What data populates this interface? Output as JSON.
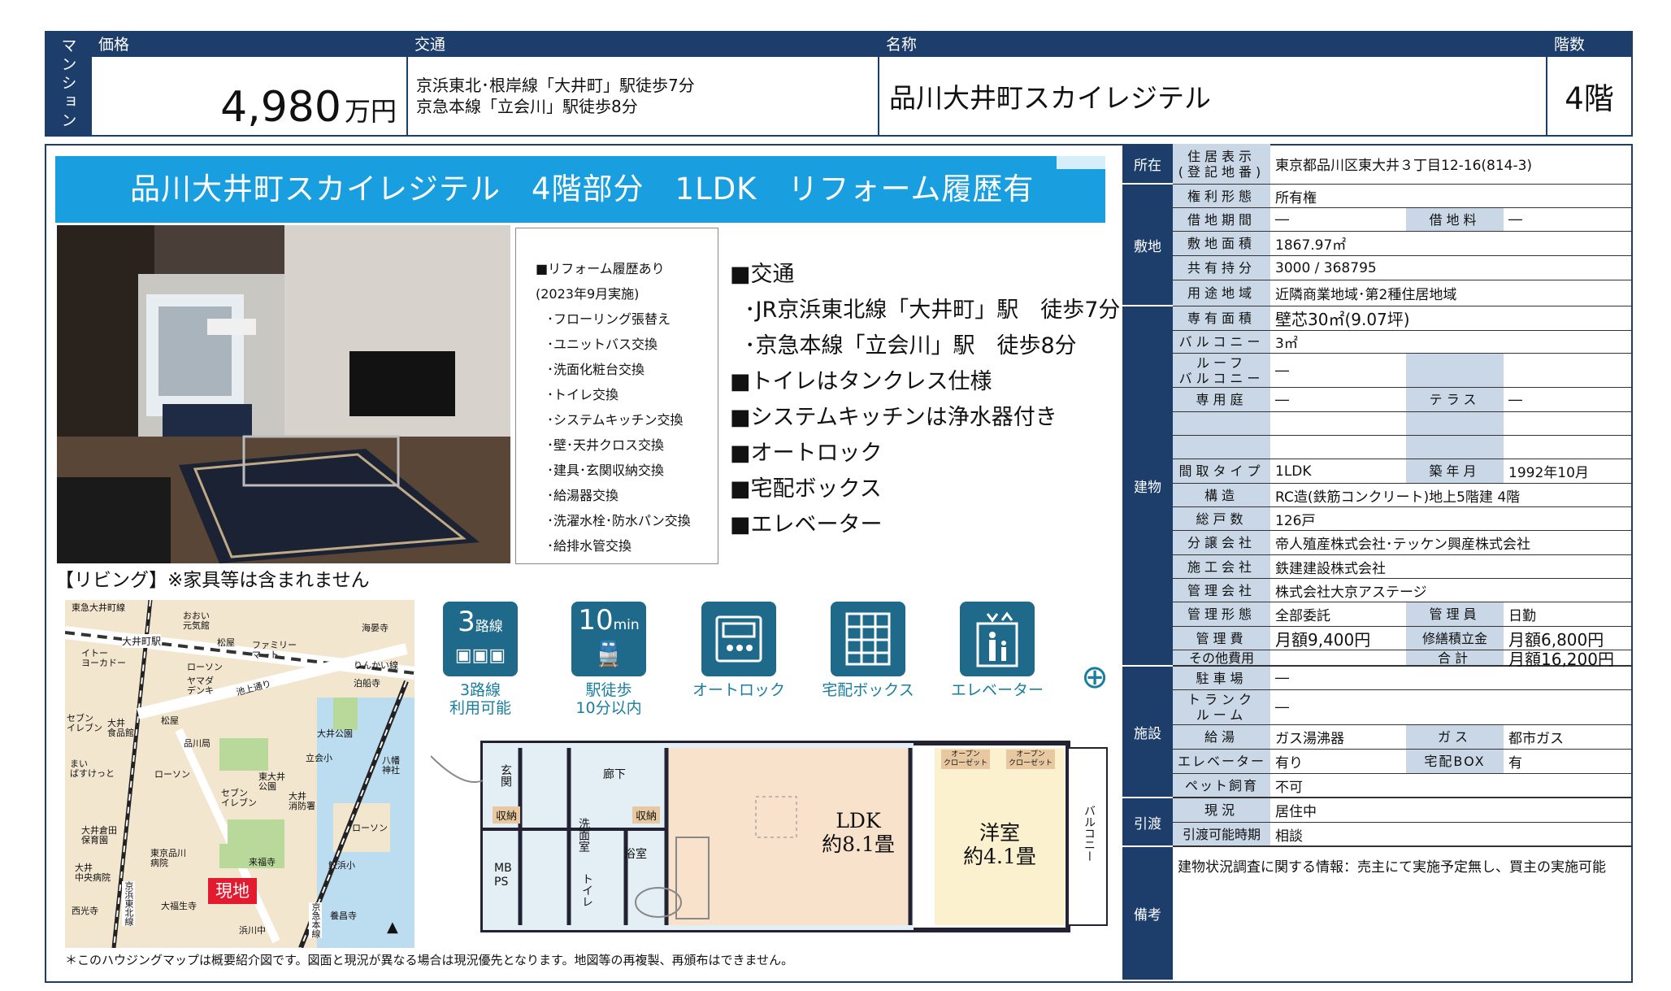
{
  "header": {
    "type_label": "マンション",
    "price_label": "価格",
    "price_value": "4,980",
    "price_unit": "万円",
    "transport_label": "交通",
    "transport_lines": [
      "京浜東北･根岸線「大井町」駅徒歩7分",
      "京急本線「立会川」駅徒歩8分"
    ],
    "name_label": "名称",
    "name_value": "品川大井町スカイレジテル",
    "floor_label": "階数",
    "floor_value": "4階"
  },
  "banner": {
    "title": "品川大井町スカイレジテル　4階部分　1LDK　リフォーム履歴有"
  },
  "photo": {
    "caption": "【リビング】※家具等は含まれません"
  },
  "reform": {
    "lines": [
      "■リフォーム履歴あり",
      "(2023年9月実施)",
      "･フローリング張替え",
      "･ユニットバス交換",
      "･洗面化粧台交換",
      "･トイレ交換",
      "･システムキッチン交換",
      "･壁･天井クロス交換",
      "･建具･玄関収納交換",
      "･給湯器交換",
      "･洗濯水栓･防水パン交換",
      "･給排水管交換"
    ]
  },
  "features": [
    "■交通",
    "･JR京浜東北線「大井町」駅　徒歩7分",
    "･京急本線「立会川」駅　徒歩8分",
    "■トイレはタンクレス仕様",
    "■システムキッチンは浄水器付き",
    "■オートロック",
    "■宅配ボックス",
    "■エレベーター"
  ],
  "icons": [
    {
      "top": "3",
      "top_unit": "路線",
      "label": "3路線\n利用可能",
      "icon": "train-lines-icon"
    },
    {
      "top": "10",
      "top_unit": "min",
      "label": "駅徒歩\n10分以内",
      "icon": "train-icon"
    },
    {
      "label": "オートロック",
      "icon": "intercom-icon"
    },
    {
      "label": "宅配ボックス",
      "icon": "delivery-box-icon"
    },
    {
      "label": "エレベーター",
      "icon": "elevator-icon"
    }
  ],
  "map": {
    "labels": [
      "東急大井町線",
      "おおい\n元気館",
      "松屋",
      "ファミリー\nマート",
      "大井町駅",
      "イトー\nヨーカドー",
      "ローソン",
      "ヤマダ\nデンキ",
      "池上通り",
      "海晏寺",
      "りんかい線",
      "泊船寺",
      "セブン\nイレブン",
      "大井\n食品館",
      "松屋",
      "品川局",
      "大井公園",
      "立会小",
      "八幡\n神社",
      "まい\nばすけっと",
      "ローソン",
      "東大井\n公園",
      "セブン\nイレブン",
      "大井\n消防署",
      "大井倉田\n保育園",
      "東京品川\n病院",
      "来福寺",
      "ローソン",
      "大井\n中央病院",
      "鮫浜小",
      "西光寺",
      "大福生寺",
      "浜川中",
      "養昌寺",
      "京浜東北線",
      "京急本線",
      "現地"
    ]
  },
  "floorplan": {
    "labels": [
      "玄関",
      "廊下",
      "収納",
      "収納",
      "MB\nPS",
      "洗面室",
      "トイレ",
      "浴室",
      "LDK\n約8.1畳",
      "洋室\n約4.1畳",
      "オープン\nクローゼット",
      "オープン\nクローゼット",
      "バルコニー"
    ]
  },
  "note": "＊このハウジングマップは概要紹介図です。図面と現況が異なる場合は現況優先となります。地図等の再複製、再頒布はできません。",
  "table": {
    "cats": [
      "所在",
      "敷地",
      "建物",
      "施設",
      "引渡",
      "備考"
    ],
    "address_label": "住居表示\n(登記地番)",
    "address": "東京都品川区東大井３丁目12-16(814-3)",
    "rights_label": "権利形態",
    "rights": "所有権",
    "lease_label": "借地期間",
    "lease": "―",
    "rent_label": "借地料",
    "rent": "―",
    "land_area_label": "敷地面積",
    "land_area": "1867.97㎡",
    "share_label": "共有持分",
    "share": "3000 / 368795",
    "zone_label": "用途地域",
    "zone": "近隣商業地域･第2種住居地域",
    "area_label": "専有面積",
    "area": "壁芯30㎡(9.07坪)",
    "balcony_label": "バルコニー",
    "balcony": "3㎡",
    "roof_label": "ルーフ\nバルコニー",
    "roof": "―",
    "garden_label": "専用庭",
    "garden": "―",
    "terrace_label": "テラス",
    "terrace": "―",
    "layout_label": "間取タイプ",
    "layout": "1LDK",
    "built_label": "築年月",
    "built": "1992年10月",
    "structure_label": "構造",
    "structure": "RC造(鉄筋コンクリート)地上5階建 4階",
    "units_label": "総戸数",
    "units": "126戸",
    "seller_label": "分譲会社",
    "seller": "帝人殖産株式会社･テッケン興産株式会社",
    "builder_label": "施工会社",
    "builder": "鉄建建設株式会社",
    "manager_label": "管理会社",
    "manager": "株式会社大京アステージ",
    "mgmt_form_label": "管理形態",
    "mgmt_form": "全部委託",
    "mgr_staff_label": "管理員",
    "mgr_staff": "日勤",
    "fee_label": "管理費",
    "fee": "月額9,400円",
    "reserve_label": "修繕積立金",
    "reserve": "月額6,800円",
    "other_label": "その他費用",
    "other": "",
    "total_label": "合計",
    "total": "月額16,200円",
    "parking_label": "駐車場",
    "parking": "―",
    "trunk_label": "トランク\nルーム",
    "trunk": "―",
    "water_label": "給湯",
    "water": "ガス湯沸器",
    "gas_label": "ガス",
    "gas": "都市ガス",
    "elev_label": "エレベーター",
    "elev": "有り",
    "box_label": "宅配BOX",
    "box": "有",
    "pet_label": "ペット飼育",
    "pet": "不可",
    "status_label": "現況",
    "status": "居住中",
    "handover_label": "引渡可能時期",
    "handover": "相談",
    "remarks": "建物状況調査に関する情報：売主にて実施予定無し、買主の実施可能"
  }
}
